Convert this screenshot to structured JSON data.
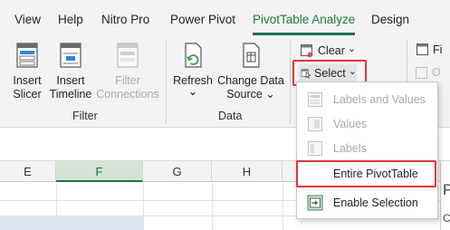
{
  "tabs": [
    "View",
    "Help",
    "Nitro Pro",
    "Power Pivot",
    "PivotTable Analyze",
    "Design"
  ],
  "ribbon": {
    "filter_group": {
      "label": "Filter",
      "insert_slicer": [
        "Insert",
        "Slicer"
      ],
      "insert_timeline": [
        "Insert",
        "Timeline"
      ],
      "filter_connections": [
        "Filter",
        "Connections"
      ]
    },
    "data_group": {
      "label": "Data",
      "refresh": "Refresh",
      "refresh_arrow": "⌄",
      "change_data_source": [
        "Change Data",
        "Source ⌄"
      ]
    },
    "actions": {
      "clear": "Clear",
      "select": "Select",
      "caret": "⌄"
    },
    "right_partial": {
      "fi": "Fi",
      "o": "O"
    }
  },
  "sheet": {
    "columns": [
      "E",
      "F",
      "G",
      "H"
    ],
    "selected_column": "F",
    "right_partial_letter": "P",
    "right_partial_letter2": "C"
  },
  "select_menu": {
    "items": [
      {
        "label": "Labels and Values",
        "enabled": false
      },
      {
        "label": "Values",
        "enabled": false
      },
      {
        "label": "Labels",
        "enabled": false
      },
      {
        "label": "Entire PivotTable",
        "enabled": true
      },
      {
        "label": "Enable Selection",
        "enabled": true
      }
    ]
  },
  "colors": {
    "accent_green": "#217346",
    "highlight_red": "#e0353a"
  }
}
